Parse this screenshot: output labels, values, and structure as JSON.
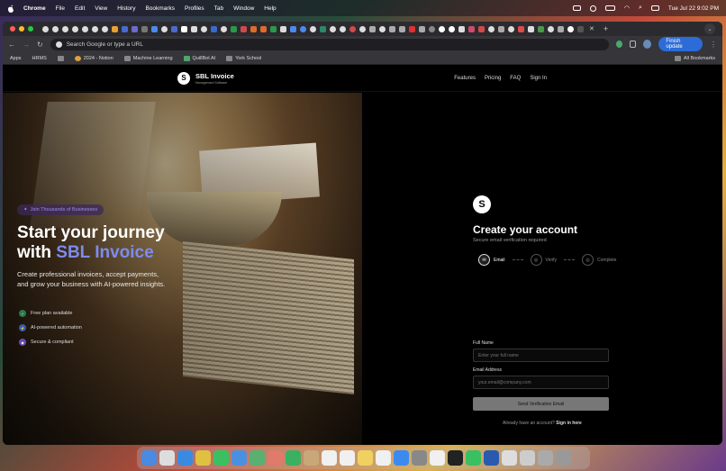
{
  "menubar": {
    "app": "Chrome",
    "items": [
      "File",
      "Edit",
      "View",
      "History",
      "Bookmarks",
      "Profiles",
      "Tab",
      "Window",
      "Help"
    ],
    "clock": "Tue Jul 22  9:02 PM"
  },
  "browser": {
    "address_placeholder": "Search Google or type a URL",
    "update_label": "Finish update",
    "bookmarks": [
      "Apps",
      "HRMS",
      "2024 - Notion",
      "Machine Learning",
      "QuillBot AI",
      "York School"
    ],
    "all_bookmarks": "All Bookmarks"
  },
  "site": {
    "brand": "SBL Invoice",
    "brand_sub": "Management Software",
    "logo_letter": "S",
    "nav": [
      "Features",
      "Pricing",
      "FAQ",
      "Sign In"
    ]
  },
  "hero": {
    "pill": "Join Thousands of Businesses",
    "headline_1": "Start your journey",
    "headline_2_prefix": "with ",
    "headline_2_accent": "SBL Invoice",
    "lead": "Create professional invoices, accept payments, and grow your business with AI-powered insights.",
    "features": [
      "Free plan available",
      "AI-powered automation",
      "Secure & compliant"
    ]
  },
  "signup": {
    "title": "Create your account",
    "subtitle": "Secure email verification required",
    "steps": [
      "Email",
      "Verify",
      "Complete"
    ],
    "full_name_label": "Full Name",
    "full_name_placeholder": "Enter your full name",
    "email_label": "Email Address",
    "email_placeholder": "your.email@company.com",
    "submit": "Send Verification Email",
    "signin_prompt": "Already have an account?",
    "signin_link": "Sign in here"
  },
  "colors": {
    "accent": "#7c8cf0",
    "pill_text": "#9b8cf0",
    "button_disabled": "#777777",
    "update_blue": "#2d6bd6"
  }
}
